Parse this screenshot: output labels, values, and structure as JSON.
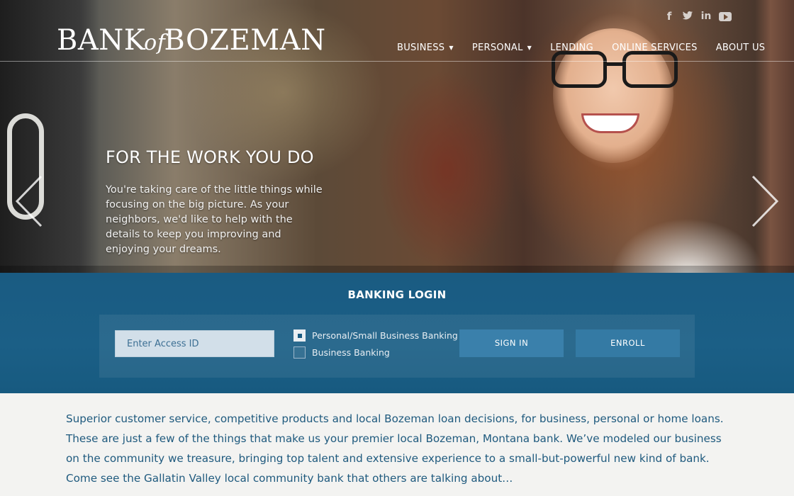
{
  "brand": {
    "logo_part1": "Bank",
    "logo_of": "of",
    "logo_part2": "Bozeman"
  },
  "social": [
    {
      "icon": "facebook-icon",
      "glyph": "f"
    },
    {
      "icon": "twitter-icon",
      "glyph": "t"
    },
    {
      "icon": "linkedin-icon",
      "glyph": "in"
    },
    {
      "icon": "youtube-icon",
      "glyph": ""
    }
  ],
  "nav": {
    "business": "BUSINESS",
    "personal": "PERSONAL",
    "lending": "LENDING",
    "online_services": "ONLINE SERVICES",
    "about_us": "ABOUT US",
    "caret": "▼"
  },
  "hero": {
    "title": "FOR THE WORK YOU DO",
    "body": "You're taking care of the little things while focusing on the big picture. As your neighbors, we'd like to help with the details to keep you improving and enjoying your dreams."
  },
  "login": {
    "title": "BANKING LOGIN",
    "access_placeholder": "Enter Access ID",
    "option_personal": "Personal/Small Business Banking",
    "option_business": "Business Banking",
    "option_personal_checked": true,
    "sign_in": "SIGN IN",
    "enroll": "ENROLL"
  },
  "intro": {
    "text": "Superior customer service, competitive products and local Bozeman loan decisions, for business, personal or home loans. These are just a few of the things that make us your premier local Bozeman, Montana bank. We’ve modeled our business on the community we treasure, bringing top talent and extensive experience to a small-but-powerful new kind of bank. Come see the Gallatin Valley local community bank that others are talking about…"
  },
  "colors": {
    "login_bg": "#1a5b82",
    "button_bg": "#3a80ab",
    "intro_text": "#1f5a7e",
    "page_bg": "#f3f3f1"
  }
}
